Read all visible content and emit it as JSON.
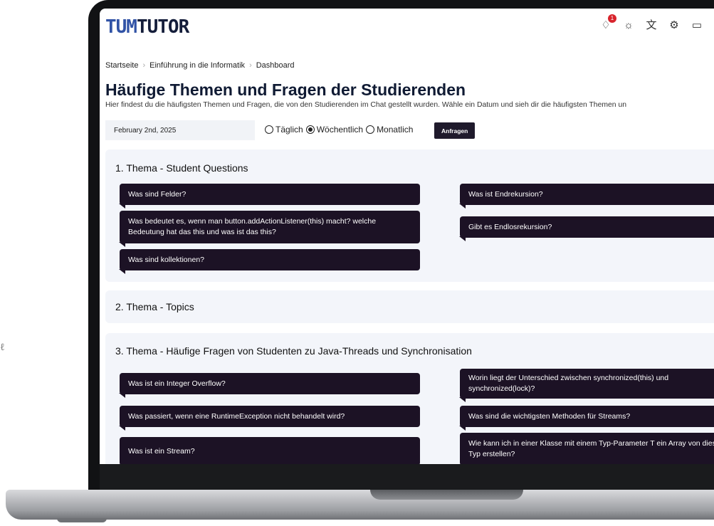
{
  "app": {
    "logo_a": "TUM",
    "logo_b": "TUTOR"
  },
  "header_icons": [
    {
      "icon": "bell-icon",
      "glyph": "♢",
      "badge": "1"
    },
    {
      "icon": "sun-icon",
      "glyph": "☼"
    },
    {
      "icon": "translate-icon",
      "glyph": "文"
    },
    {
      "icon": "gear-icon",
      "glyph": "⚙"
    },
    {
      "icon": "chat-icon",
      "glyph": "▭"
    }
  ],
  "breadcrumb": [
    "Startseite",
    "Einführung in die Informatik",
    "Dashboard"
  ],
  "page": {
    "title": "Häufige Themen und Fragen der Studierenden",
    "description": "Hier findest du die häufigsten Themen und Fragen, die von den Studierenden im Chat gestellt wurden. Wähle ein Datum und sieh dir die häufigsten Themen un"
  },
  "controls": {
    "date_value": "February 2nd, 2025",
    "radios": [
      {
        "label": "Täglich",
        "selected": false
      },
      {
        "label": "Wöchentlich",
        "selected": true
      },
      {
        "label": "Monatlich",
        "selected": false
      }
    ],
    "submit_label": "Anfragen"
  },
  "topics": [
    {
      "title": "1. Thema - Student Questions",
      "left": [
        "Was sind Felder?",
        "Was bedeutet es, wenn man button.addActionListener(this) macht? welche Bedeutung hat das this und was ist das this?",
        "Was sind kollektionen?"
      ],
      "right": [
        "Was ist Endrekursion?",
        "Gibt es Endlosrekursion?"
      ]
    },
    {
      "title": "2. Thema - Topics",
      "left": [],
      "right": []
    },
    {
      "title": "3. Thema - Häufige Fragen von Studenten zu Java-Threads und Synchronisation",
      "left": [
        "Was ist ein Integer Overflow?",
        "Was passiert, wenn eine RuntimeException nicht behandelt wird?",
        "Was ist ein Stream?"
      ],
      "right": [
        "Worin liegt der Unterschied zwischen synchronized(this) und synchronized(lock)?",
        "Was sind die wichtigsten Methoden für Streams?",
        "Wie kann ich in einer Klasse mit einem Typ-Parameter T ein Array von diesem Typ erstellen?"
      ]
    }
  ]
}
